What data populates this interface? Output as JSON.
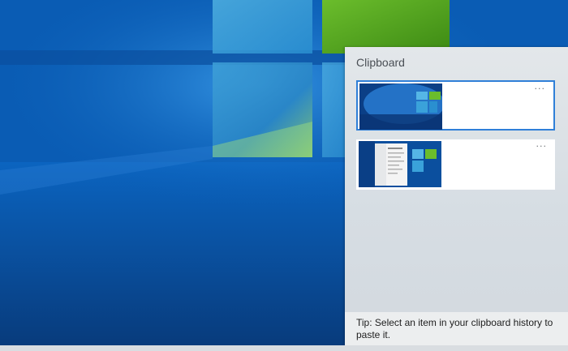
{
  "clipboard": {
    "title": "Clipboard",
    "items": [
      {
        "thumbnail": "windows-desktop-screenshot",
        "selected": true,
        "more_label": "···"
      },
      {
        "thumbnail": "settings-window-screenshot",
        "selected": false,
        "more_label": "···"
      }
    ],
    "tip": "Tip: Select an item in your clipboard history to paste it."
  },
  "colors": {
    "accent": "#2f7fd8",
    "panel": "#dde2e6",
    "desktop": "#0a5fb8"
  }
}
